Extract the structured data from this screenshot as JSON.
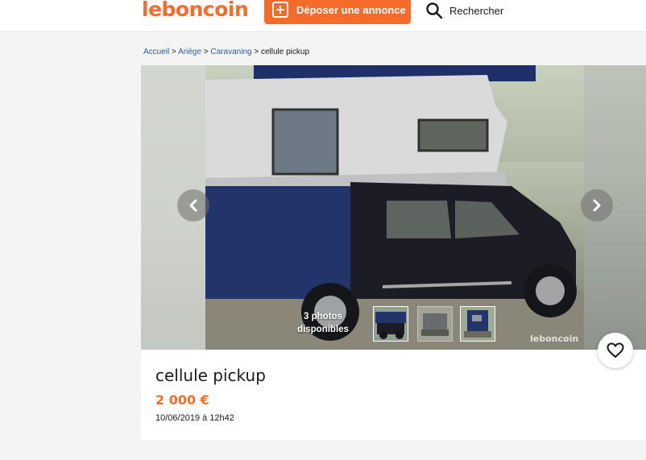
{
  "brand": {
    "logo_text": "leboncoin",
    "accent_color": "#f56b2a"
  },
  "header": {
    "post_ad_label": "Déposer une annonce",
    "post_ad_icon": "plus-square-icon",
    "search_label": "Rechercher",
    "search_icon": "search-icon"
  },
  "breadcrumb": {
    "items": [
      "Accueil",
      "Ariège",
      "Caravaning"
    ],
    "current": "cellule pickup",
    "separator": ">"
  },
  "gallery": {
    "photo_count_text": "3 photos disponibles",
    "prev_icon": "chevron-left-icon",
    "next_icon": "chevron-right-icon",
    "watermark": "leboncoin"
  },
  "ad": {
    "title": "cellule pickup",
    "price": "2 000 €",
    "date": "10/06/2019 à 12h42",
    "favorite_icon": "heart-icon"
  }
}
